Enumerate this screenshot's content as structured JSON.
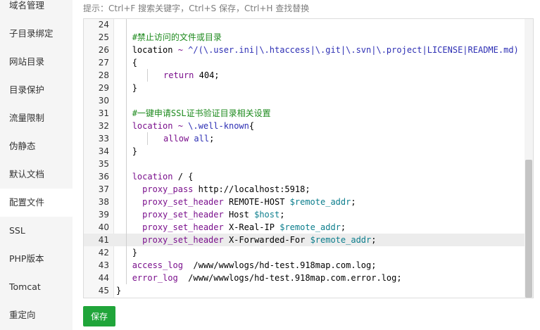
{
  "sidebar": {
    "items": [
      {
        "label": "域名管理"
      },
      {
        "label": "子目录绑定"
      },
      {
        "label": "网站目录"
      },
      {
        "label": "目录保护"
      },
      {
        "label": "流量限制"
      },
      {
        "label": "伪静态"
      },
      {
        "label": "默认文档"
      },
      {
        "label": "配置文件"
      },
      {
        "label": "SSL"
      },
      {
        "label": "PHP版本"
      },
      {
        "label": "Tomcat"
      },
      {
        "label": "重定向"
      }
    ],
    "active": "配置文件"
  },
  "hint": "提示：Ctrl+F 搜索关键字，Ctrl+S 保存，Ctrl+H 查找替换",
  "editor": {
    "active_line": 41,
    "lines": [
      {
        "n": "24",
        "guides": 1,
        "tokens": []
      },
      {
        "n": "25",
        "guides": 1,
        "tokens": [
          {
            "t": "#禁止访问的文件或目录",
            "c": "cm"
          }
        ]
      },
      {
        "n": "26",
        "guides": 1,
        "tokens": [
          {
            "t": "location",
            "c": ""
          },
          {
            "t": " ~ ",
            "c": "kw"
          },
          {
            "t": "^/(\\.user.ini|\\.htaccess|\\.git|\\.svn|\\.project|LICENSE|README.md)",
            "c": "str"
          }
        ]
      },
      {
        "n": "27",
        "guides": 1,
        "tokens": [
          {
            "t": "{",
            "c": ""
          }
        ]
      },
      {
        "n": "28",
        "guides": 2,
        "tokens": [
          {
            "t": "return",
            "c": "kw"
          },
          {
            "t": " 404;",
            "c": "num"
          }
        ]
      },
      {
        "n": "29",
        "guides": 1,
        "tokens": [
          {
            "t": "}",
            "c": ""
          }
        ]
      },
      {
        "n": "30",
        "guides": 1,
        "tokens": []
      },
      {
        "n": "31",
        "guides": 1,
        "tokens": [
          {
            "t": "#一键申请SSL证书验证目录相关设置",
            "c": "cm"
          }
        ]
      },
      {
        "n": "32",
        "guides": 1,
        "tokens": [
          {
            "t": "location",
            "c": "kw"
          },
          {
            "t": " ~ ",
            "c": "kw"
          },
          {
            "t": "\\.well-known",
            "c": "str"
          },
          {
            "t": "{",
            "c": ""
          }
        ]
      },
      {
        "n": "33",
        "guides": 2,
        "tokens": [
          {
            "t": "allow",
            "c": "kw"
          },
          {
            "t": " all",
            "c": "str"
          },
          {
            "t": ";",
            "c": ""
          }
        ]
      },
      {
        "n": "34",
        "guides": 1,
        "tokens": [
          {
            "t": "}",
            "c": ""
          }
        ]
      },
      {
        "n": "35",
        "guides": 1,
        "tokens": []
      },
      {
        "n": "36",
        "guides": 1,
        "tokens": [
          {
            "t": "location",
            "c": "kw"
          },
          {
            "t": " / {",
            "c": ""
          }
        ]
      },
      {
        "n": "37",
        "guides": 1,
        "indent": true,
        "tokens": [
          {
            "t": "proxy_pass",
            "c": "kw"
          },
          {
            "t": " http://localhost:5918;",
            "c": ""
          }
        ]
      },
      {
        "n": "38",
        "guides": 1,
        "indent": true,
        "tokens": [
          {
            "t": "proxy_set_header",
            "c": "kw"
          },
          {
            "t": " REMOTE-HOST ",
            "c": ""
          },
          {
            "t": "$remote_addr",
            "c": "var"
          },
          {
            "t": ";",
            "c": ""
          }
        ]
      },
      {
        "n": "39",
        "guides": 1,
        "indent": true,
        "tokens": [
          {
            "t": "proxy_set_header",
            "c": "kw"
          },
          {
            "t": " Host ",
            "c": ""
          },
          {
            "t": "$host",
            "c": "var"
          },
          {
            "t": ";",
            "c": ""
          }
        ]
      },
      {
        "n": "40",
        "guides": 1,
        "indent": true,
        "tokens": [
          {
            "t": "proxy_set_header",
            "c": "kw"
          },
          {
            "t": " X-Real-IP ",
            "c": ""
          },
          {
            "t": "$remote_addr",
            "c": "var"
          },
          {
            "t": ";",
            "c": ""
          }
        ]
      },
      {
        "n": "41",
        "guides": 1,
        "indent": true,
        "tokens": [
          {
            "t": "proxy_set_header",
            "c": "kw"
          },
          {
            "t": " X-Forwarded-For ",
            "c": ""
          },
          {
            "t": "$remote_addr",
            "c": "var"
          },
          {
            "t": ";",
            "c": ""
          }
        ]
      },
      {
        "n": "42",
        "guides": 1,
        "tokens": [
          {
            "t": "}",
            "c": ""
          }
        ]
      },
      {
        "n": "43",
        "guides": 1,
        "tokens": [
          {
            "t": "access_log",
            "c": "kw"
          },
          {
            "t": "  /www/wwwlogs/hd-test.918map.com.log;",
            "c": ""
          }
        ]
      },
      {
        "n": "44",
        "guides": 1,
        "tokens": [
          {
            "t": "error_log",
            "c": "kw"
          },
          {
            "t": "  /www/wwwlogs/hd-test.918map.com.error.log;",
            "c": ""
          }
        ]
      },
      {
        "n": "45",
        "guides": 0,
        "tokens": [
          {
            "t": "}",
            "c": ""
          }
        ]
      }
    ]
  },
  "save_button": {
    "label": "保存",
    "color": "#20a53a"
  }
}
